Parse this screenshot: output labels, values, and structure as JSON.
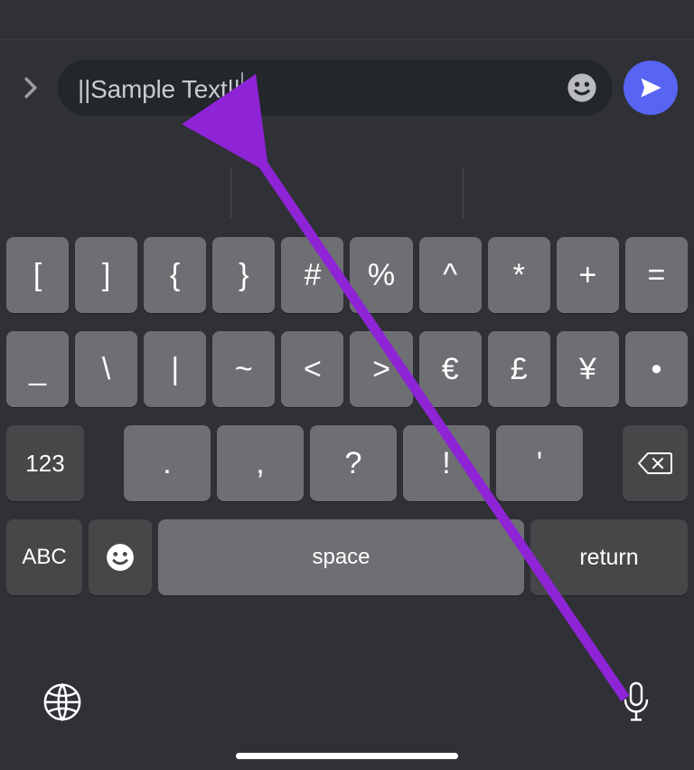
{
  "input_bar": {
    "message_text": "||Sample Text||"
  },
  "keyboard": {
    "row1": [
      "[",
      "]",
      "{",
      "}",
      "#",
      "%",
      "^",
      "*",
      "+",
      "="
    ],
    "row2": [
      "_",
      "\\",
      "|",
      "~",
      "<",
      ">",
      "€",
      "£",
      "¥",
      "•"
    ],
    "row3_123": "123",
    "row3_punct": [
      ".",
      ",",
      "?",
      "!",
      "'"
    ],
    "row4": {
      "abc": "ABC",
      "space": "space",
      "return": "return"
    }
  }
}
